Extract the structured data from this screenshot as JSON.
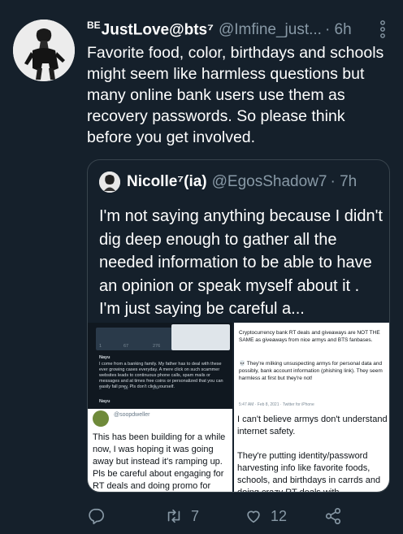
{
  "tweet": {
    "name_prefix": "BE",
    "name": "JustLove@bts⁷",
    "handle": "@Imfine_just...",
    "time": "· 6h",
    "text": "Favorite food, color, birthdays and schools might seem like harmless questions but many online bank users use them as recovery passwords. So please think before you get involved.",
    "icons": {
      "more": "vertical-dots-icon",
      "reply": "reply-icon",
      "retweet": "retweet-icon",
      "like": "heart-icon",
      "share": "share-icon"
    },
    "retweets": "7",
    "likes": "12"
  },
  "quoted": {
    "name": "Nicolle⁷(ia)",
    "handle": "@EgosShadow7",
    "time": "· 7h",
    "text": "I'm not saying anything because I didn't dig deep enough to gather all the needed information to be able to have an opinion or speak myself about it . I'm just saying be careful a...",
    "media": {
      "left_top": {
        "handle1": "Nayu",
        "handle2": "Nayu",
        "small_text": "I come from a banking family. My father has to deal with these ever growing cases everyday. A mere click on such scammer websites leads to continuous phone calls, spam mails or messages and at times free coins or personalized that you can easily fall prey. Pls don't click yourself.",
        "counts": [
          "1",
          "67",
          "276",
          "2",
          "11",
          "24"
        ]
      },
      "left_bottom": {
        "handle": "@soopdweller",
        "text": "This has been building for a while now, I was hoping it was going away but instead it's ramping up. Pls be careful about engaging for RT deals and doing promo for"
      },
      "right_top": {
        "line1": "Cryptocurrency bank RT deals and giveaways are NOT THE SAME as giveaways from nice armys and BTS fanbases.",
        "line2": "💀 They're milking unsuspecting armys for personal data and possibly, bank account information (phishing link). They seem harmless at first but they're not!",
        "meta": "5:47 AM · Feb 8, 2021 · Twitter for iPhone"
      },
      "right_bottom": {
        "text": "I can't believe armys don't understand internet safety.\n\nThey're putting identity/password harvesting info like favorite foods, schools, and birthdays in carrds and doing crazy RT deals with cryptocurrency banks"
      }
    }
  },
  "colors": {
    "background": "#15202b",
    "secondary_text": "#8899a6",
    "border": "#38444d"
  }
}
